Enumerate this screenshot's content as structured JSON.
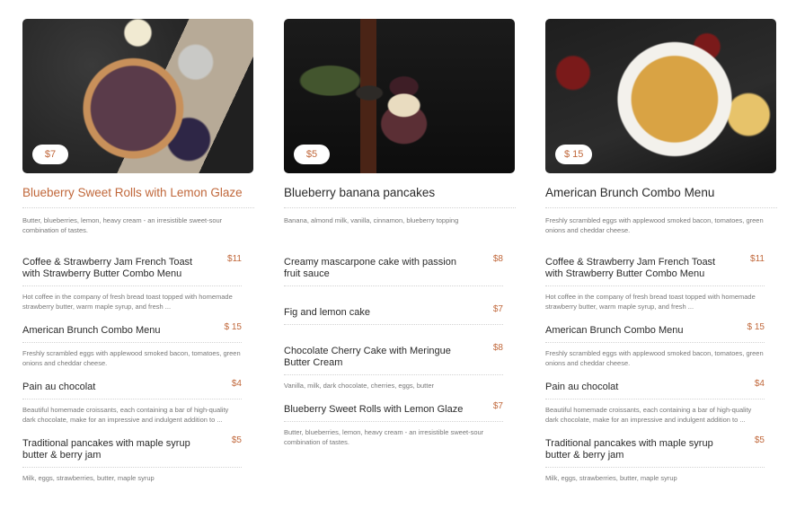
{
  "columns": [
    {
      "feature": {
        "image": "blueberry-rolls-photo",
        "price": "$7",
        "title": "Blueberry Sweet Rolls with Lemon Glaze",
        "desc": "Butter, blueberries, lemon, heavy cream - an irresistible sweet-sour combination of tastes."
      },
      "items": [
        {
          "name": "Coffee & Strawberry Jam French Toast with Strawberry Butter Combo Menu",
          "price": "$11",
          "desc": "Hot coffee in the company of fresh bread toast topped with homemade strawberry butter, warm maple syrup, and fresh ..."
        },
        {
          "name": "American Brunch Combo Menu",
          "price": "$ 15",
          "desc": "Freshly scrambled eggs with applewood smoked bacon, tomatoes, green onions and cheddar cheese."
        },
        {
          "name": "Pain au chocolat",
          "price": "$4",
          "desc": "Beautiful homemade croissants, each containing a bar of high-quality dark chocolate, make for an impressive and indulgent addition to ..."
        },
        {
          "name": "Traditional pancakes with maple syrup butter & berry jam",
          "price": "$5",
          "desc": "Milk, eggs, strawberries, butter, maple syrup"
        }
      ]
    },
    {
      "feature": {
        "image": "pancake-stack-photo",
        "price": "$5",
        "title": "Blueberry banana pancakes",
        "desc": "Banana, almond milk, vanilla, cinnamon, blueberry topping"
      },
      "items": [
        {
          "name": "Creamy mascarpone cake with passion fruit sauce",
          "price": "$8",
          "desc": ""
        },
        {
          "name": "Fig and lemon cake",
          "price": "$7",
          "desc": ""
        },
        {
          "name": "Chocolate Cherry Cake with Meringue Butter Cream",
          "price": "$8",
          "desc": "Vanilla, milk, dark chocolate, cherries, eggs, butter"
        },
        {
          "name": "Blueberry Sweet Rolls with Lemon Glaze",
          "price": "$7",
          "desc": "Butter, blueberries, lemon, heavy cream - an irresistible sweet-sour combination of tastes."
        }
      ]
    },
    {
      "feature": {
        "image": "lattice-pie-photo",
        "price": "$ 15",
        "title": "American Brunch Combo Menu",
        "desc": "Freshly scrambled eggs with applewood smoked bacon, tomatoes, green onions and cheddar cheese."
      },
      "items": [
        {
          "name": "Coffee & Strawberry Jam French Toast with Strawberry Butter Combo Menu",
          "price": "$11",
          "desc": "Hot coffee in the company of fresh bread toast topped with homemade strawberry butter, warm maple syrup, and fresh ..."
        },
        {
          "name": "American Brunch Combo Menu",
          "price": "$ 15",
          "desc": "Freshly scrambled eggs with applewood smoked bacon, tomatoes, green onions and cheddar cheese."
        },
        {
          "name": "Pain au chocolat",
          "price": "$4",
          "desc": "Beautiful homemade croissants, each containing a bar of high-quality dark chocolate, make for an impressive and indulgent addition to ..."
        },
        {
          "name": "Traditional pancakes with maple syrup butter & berry jam",
          "price": "$5",
          "desc": "Milk, eggs, strawberries, butter, maple syrup"
        }
      ]
    }
  ],
  "colors": {
    "accent": "#c0673a",
    "text": "#2a2a2a",
    "muted": "#777777"
  }
}
